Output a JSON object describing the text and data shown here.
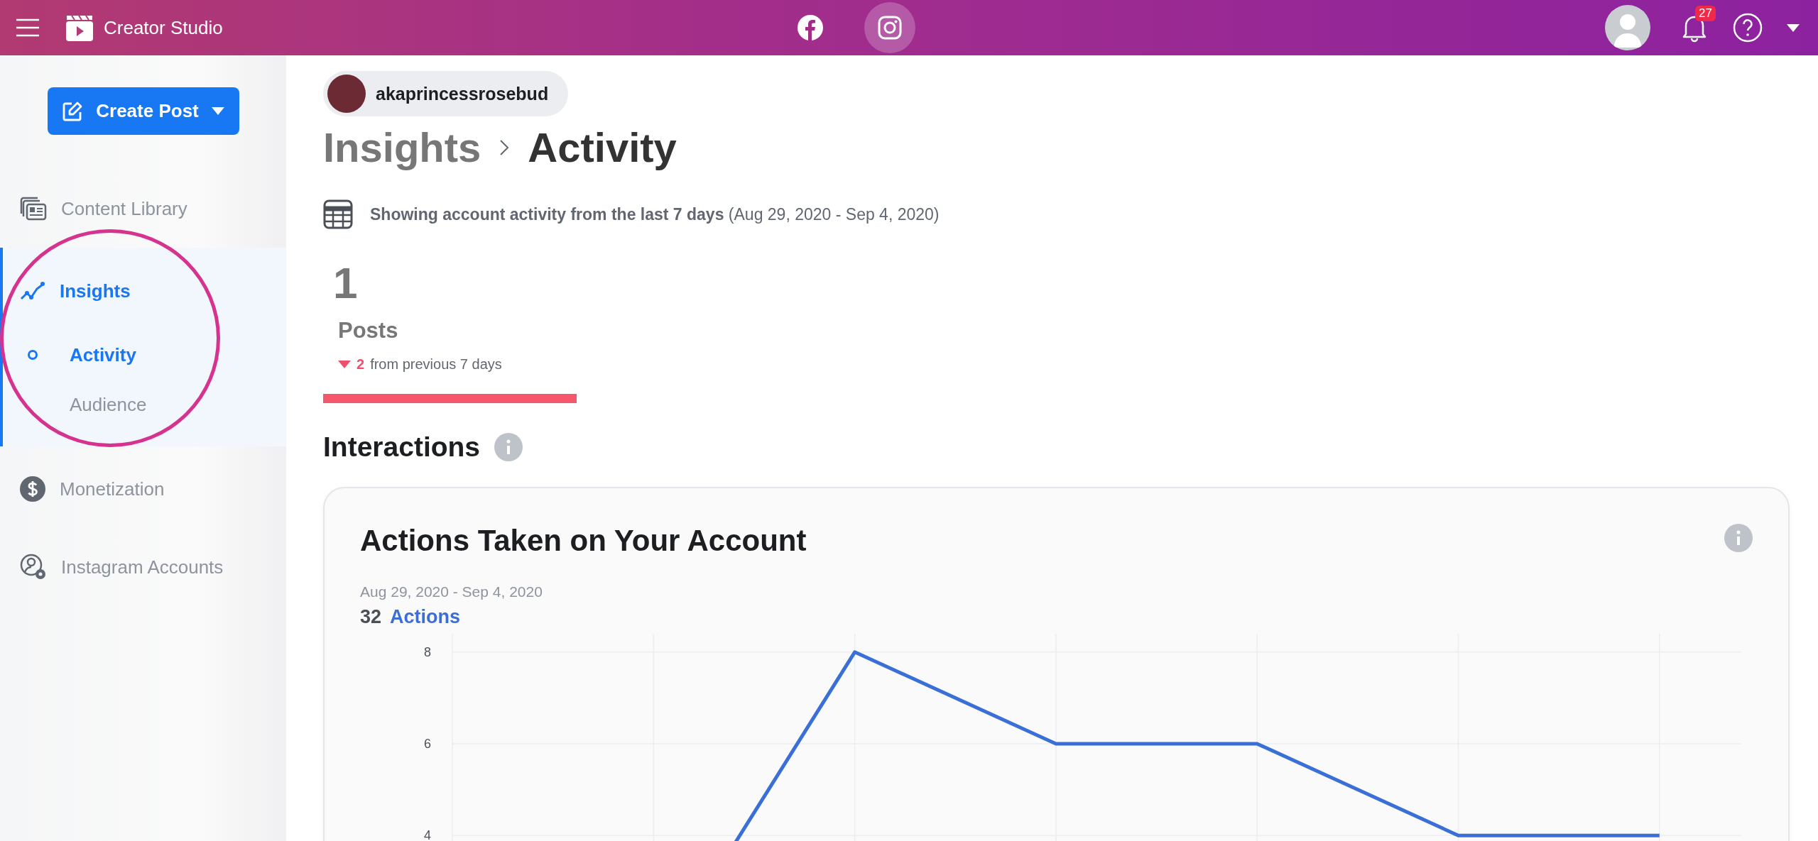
{
  "topbar": {
    "app_name": "Creator Studio",
    "platforms": [
      {
        "kind": "facebook",
        "selected": false
      },
      {
        "kind": "instagram",
        "selected": true
      }
    ],
    "notification_count": "27"
  },
  "sidebar": {
    "create_button": "Create Post",
    "items": [
      {
        "label": "Content Library",
        "selected": false
      },
      {
        "label": "Insights",
        "selected": true,
        "children": [
          {
            "label": "Activity",
            "selected": true
          },
          {
            "label": "Audience",
            "selected": false
          }
        ]
      },
      {
        "label": "Monetization",
        "selected": false
      },
      {
        "label": "Instagram Accounts",
        "selected": false
      }
    ]
  },
  "account": {
    "name": "akaprincessrosebud"
  },
  "breadcrumb": {
    "parent": "Insights",
    "current": "Activity"
  },
  "range_note": {
    "bold": "Showing account activity from the last 7 days",
    "dates": "(Aug 29, 2020 - Sep 4, 2020)"
  },
  "stat": {
    "value": "1",
    "label": "Posts",
    "change": "2",
    "change_text": "from previous 7 days"
  },
  "section_title": "Interactions",
  "card": {
    "title": "Actions Taken on Your Account",
    "date_range": "Aug 29, 2020 - Sep 4, 2020",
    "total": "32",
    "chart_data": {
      "type": "line",
      "series": [
        {
          "name": "Actions",
          "color": "#3a6fd8",
          "values": [
            null,
            1,
            8,
            6,
            6,
            4,
            4
          ]
        }
      ],
      "ylim": [
        0,
        8.4
      ],
      "yticks": [
        4,
        6,
        8
      ],
      "grid": true
    }
  }
}
